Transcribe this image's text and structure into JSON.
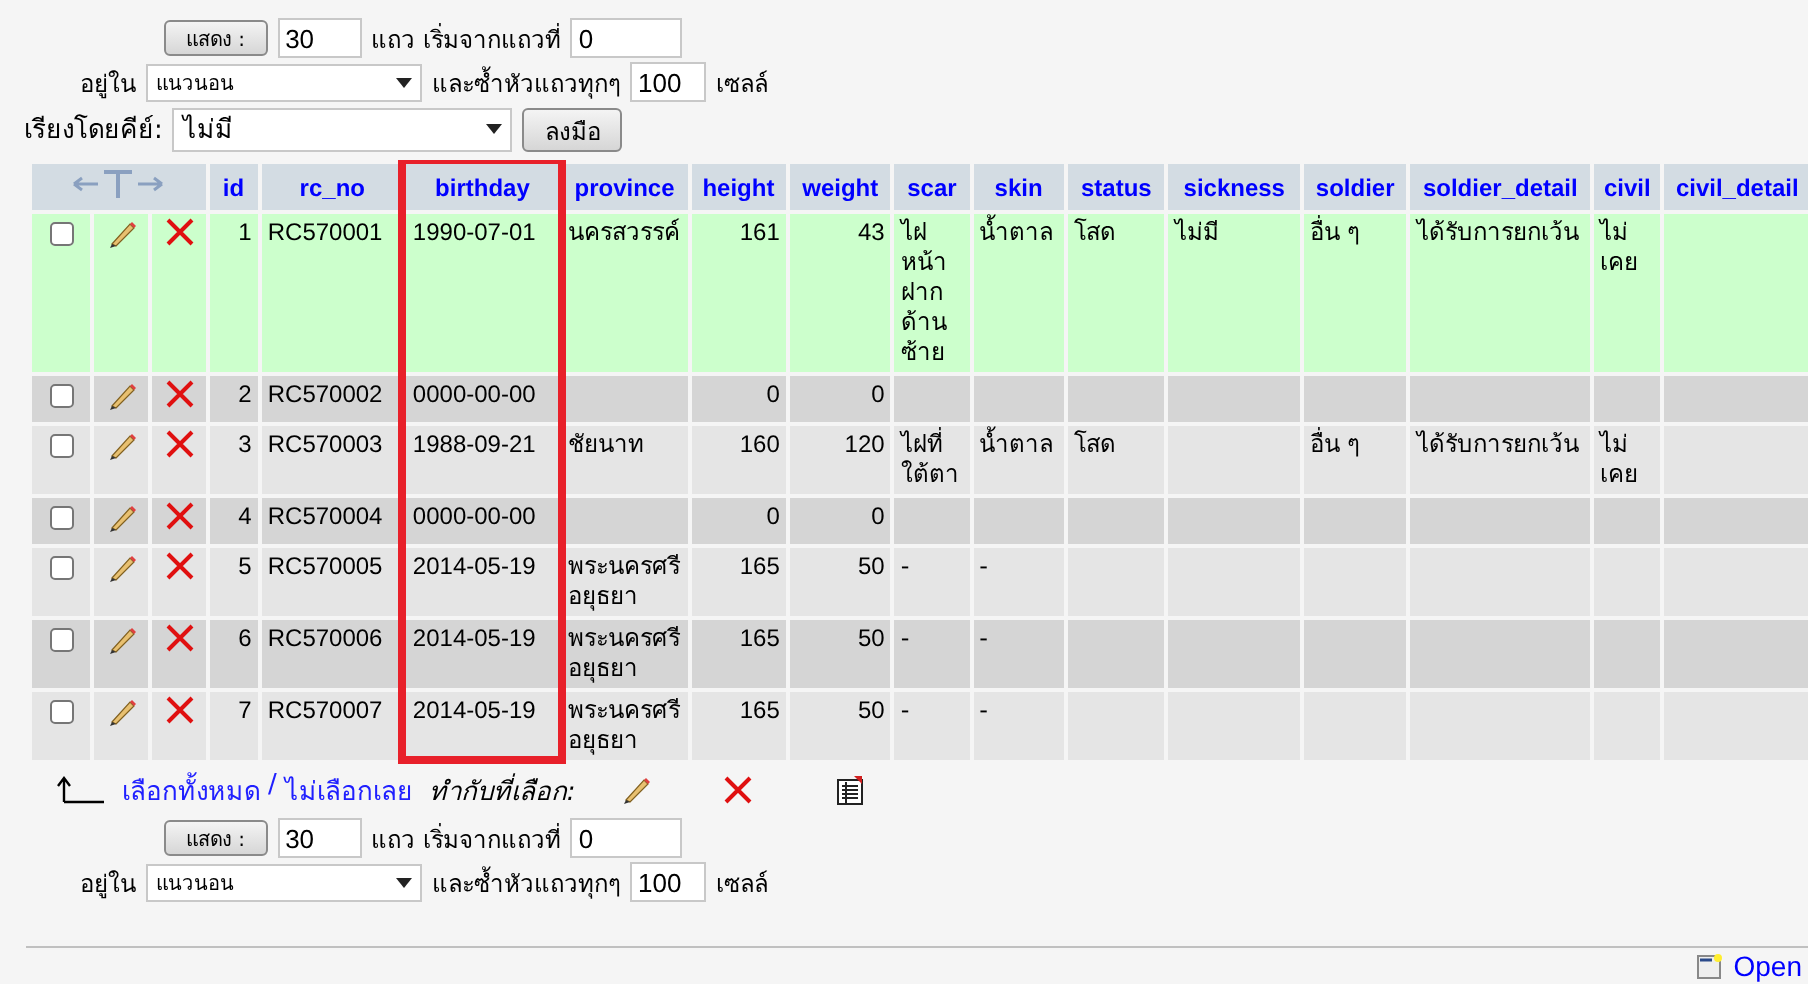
{
  "top_controls": {
    "show_button": "แสดง :",
    "rows": "30",
    "rows_label": "แถว เริ่มจากแถวที่",
    "start": "0",
    "mode_label": "อยู่ใน",
    "mode": "แนวนอน",
    "repeat_label": "และซ้ำหัวแถวทุกๆ",
    "repeat": "100",
    "cells_label": "เซลล์"
  },
  "sort": {
    "label": "เรียงโดยคีย์:",
    "value": "ไม่มี",
    "button": "ลงมือ"
  },
  "table": {
    "columns": [
      {
        "label": "id",
        "kind": "number",
        "framed": false
      },
      {
        "label": "rc_no",
        "kind": "text",
        "framed": false
      },
      {
        "label": "birthday",
        "kind": "text",
        "framed": true
      },
      {
        "label": "province",
        "kind": "text",
        "framed": false
      },
      {
        "label": "height",
        "kind": "number",
        "framed": false
      },
      {
        "label": "weight",
        "kind": "number",
        "framed": false
      },
      {
        "label": "scar",
        "kind": "text",
        "framed": false
      },
      {
        "label": "skin",
        "kind": "text",
        "framed": false
      },
      {
        "label": "status",
        "kind": "text",
        "framed": false
      },
      {
        "label": "sickness",
        "kind": "text",
        "framed": false
      },
      {
        "label": "soldier",
        "kind": "text",
        "framed": false
      },
      {
        "label": "soldier_detail",
        "kind": "text",
        "framed": false
      },
      {
        "label": "civil",
        "kind": "text",
        "framed": false
      },
      {
        "label": "civil_detail",
        "kind": "text",
        "framed": false
      }
    ],
    "rows": [
      {
        "checked": false,
        "marked": true,
        "cells": [
          "1",
          "RC570001",
          "1990-07-01",
          "นครสวรรค์",
          "161",
          "43",
          "ไฝหน้าฝากด้านซ้าย",
          "น้ำตาล",
          "โสด",
          "ไม่มี",
          "อื่น ๆ",
          "ได้รับการยกเว้น",
          "ไม่เคย",
          ""
        ]
      },
      {
        "checked": false,
        "marked": false,
        "cells": [
          "2",
          "RC570002",
          "0000-00-00",
          "",
          "0",
          "0",
          "",
          "",
          "",
          "",
          "",
          "",
          "",
          ""
        ]
      },
      {
        "checked": false,
        "marked": false,
        "cells": [
          "3",
          "RC570003",
          "1988-09-21",
          "ชัยนาท",
          "160",
          "120",
          "ไฝที่ใต้ตา",
          "น้ำตาล",
          "โสด",
          "",
          "อื่น ๆ",
          "ได้รับการยกเว้น",
          "ไม่เคย",
          ""
        ]
      },
      {
        "checked": false,
        "marked": false,
        "cells": [
          "4",
          "RC570004",
          "0000-00-00",
          "",
          "0",
          "0",
          "",
          "",
          "",
          "",
          "",
          "",
          "",
          ""
        ]
      },
      {
        "checked": false,
        "marked": false,
        "cells": [
          "5",
          "RC570005",
          "2014-05-19",
          "พระนครศรีอยุธยา",
          "165",
          "50",
          "-",
          "-",
          "",
          "",
          "",
          "",
          "",
          ""
        ]
      },
      {
        "checked": false,
        "marked": false,
        "cells": [
          "6",
          "RC570006",
          "2014-05-19",
          "พระนครศรีอยุธยา",
          "165",
          "50",
          "-",
          "-",
          "",
          "",
          "",
          "",
          "",
          ""
        ]
      },
      {
        "checked": false,
        "marked": false,
        "cells": [
          "7",
          "RC570007",
          "2014-05-19",
          "พระนครศรีอยุธยา",
          "165",
          "50",
          "-",
          "-",
          "",
          "",
          "",
          "",
          "",
          ""
        ]
      }
    ]
  },
  "selection": {
    "select_all": "เลือกทั้งหมด",
    "separator": "/",
    "select_none": "ไม่เลือกเลย",
    "with_selected": "ทำกับที่เลือก:"
  },
  "bottom_controls": {
    "show_button": "แสดง :",
    "rows": "30",
    "rows_label": "แถว เริ่มจากแถวที่",
    "start": "0",
    "mode_label": "อยู่ใน",
    "mode": "แนวนอน",
    "repeat_label": "และซ้ำหัวแถวทุกๆ",
    "repeat": "100",
    "cells_label": "เซลล์"
  },
  "footer": {
    "link": "Open"
  }
}
